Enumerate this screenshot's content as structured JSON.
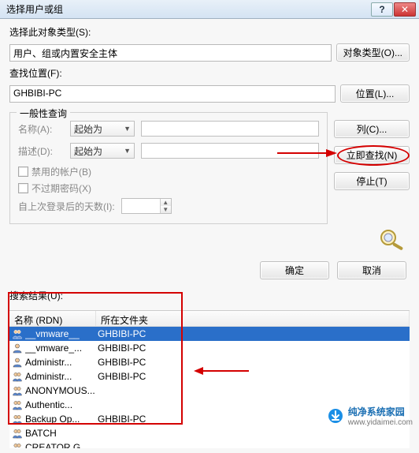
{
  "window": {
    "title": "选择用户或组",
    "help_icon": "?",
    "close_icon": "✕"
  },
  "object_type": {
    "label": "选择此对象类型(S):",
    "value": "用户、组或内置安全主体",
    "button": "对象类型(O)..."
  },
  "location": {
    "label": "查找位置(F):",
    "value": "GHBIBI-PC",
    "button": "位置(L)..."
  },
  "group": {
    "legend": "一般性查询",
    "name_label": "名称(A):",
    "name_mode": "起始为",
    "name_value": "",
    "desc_label": "描述(D):",
    "desc_mode": "起始为",
    "desc_value": "",
    "chk_disabled": "禁用的帐户(B)",
    "chk_noexpire": "不过期密码(X)",
    "days_label": "自上次登录后的天数(I):"
  },
  "right": {
    "columns_btn": "列(C)...",
    "findnow_btn": "立即查找(N)",
    "stop_btn": "停止(T)"
  },
  "footer": {
    "ok": "确定",
    "cancel": "取消"
  },
  "results": {
    "label": "搜索结果(U):",
    "col_name": "名称 (RDN)",
    "col_folder": "所在文件夹",
    "rows": [
      {
        "icon": "group",
        "name": "__vmware__",
        "folder": "GHBIBI-PC",
        "selected": true
      },
      {
        "icon": "user",
        "name": "__vmware_...",
        "folder": "GHBIBI-PC"
      },
      {
        "icon": "user",
        "name": "Administr...",
        "folder": "GHBIBI-PC"
      },
      {
        "icon": "group",
        "name": "Administr...",
        "folder": "GHBIBI-PC"
      },
      {
        "icon": "group",
        "name": "ANONYMOUS...",
        "folder": ""
      },
      {
        "icon": "group",
        "name": "Authentic...",
        "folder": ""
      },
      {
        "icon": "group",
        "name": "Backup Op...",
        "folder": "GHBIBI-PC"
      },
      {
        "icon": "group",
        "name": "BATCH",
        "folder": ""
      },
      {
        "icon": "group",
        "name": "CREATOR G...",
        "folder": ""
      }
    ]
  },
  "watermark": {
    "brand": "纯净系统家园",
    "url": "www.yidaimei.com"
  }
}
